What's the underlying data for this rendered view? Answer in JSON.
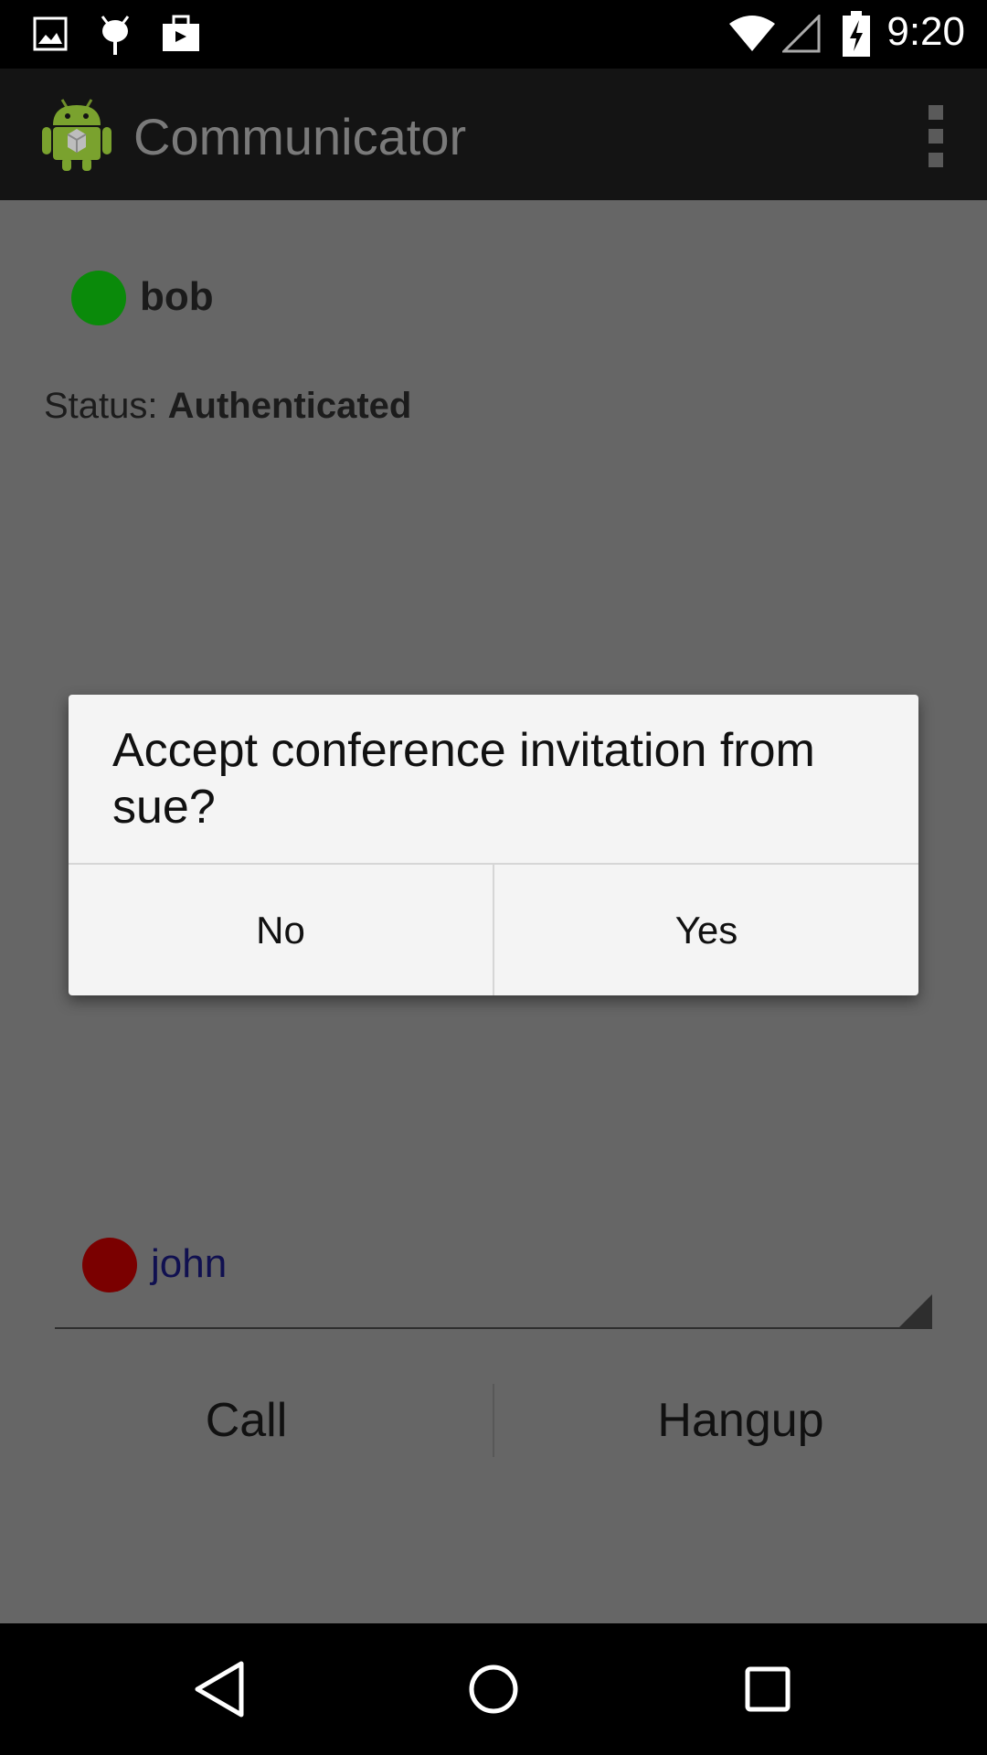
{
  "status_bar": {
    "time": "9:20",
    "left_icons": [
      "image-icon",
      "android-debug-icon",
      "briefcase-icon"
    ],
    "right_icons": [
      "wifi-icon",
      "cell-signal-icon",
      "battery-charging-icon"
    ]
  },
  "action_bar": {
    "title": "Communicator",
    "app_icon": "android-robot-icon",
    "overflow_icon": "overflow-menu-icon"
  },
  "account": {
    "name": "bob",
    "presence_color": "#0a8a0a",
    "status_label": "Status:",
    "status_value": "Authenticated"
  },
  "contact_picker": {
    "selected_contact": "john",
    "presence_color": "#7a0000"
  },
  "actions": {
    "call_label": "Call",
    "hangup_label": "Hangup"
  },
  "dialog": {
    "message": "Accept conference invitation from sue?",
    "negative_label": "No",
    "positive_label": "Yes"
  },
  "nav_bar": {
    "icons": [
      "back-icon",
      "home-icon",
      "recents-icon"
    ]
  },
  "colors": {
    "overlay_background": "#666666",
    "dialog_background": "#f4f4f4",
    "action_bar": "#141414"
  }
}
